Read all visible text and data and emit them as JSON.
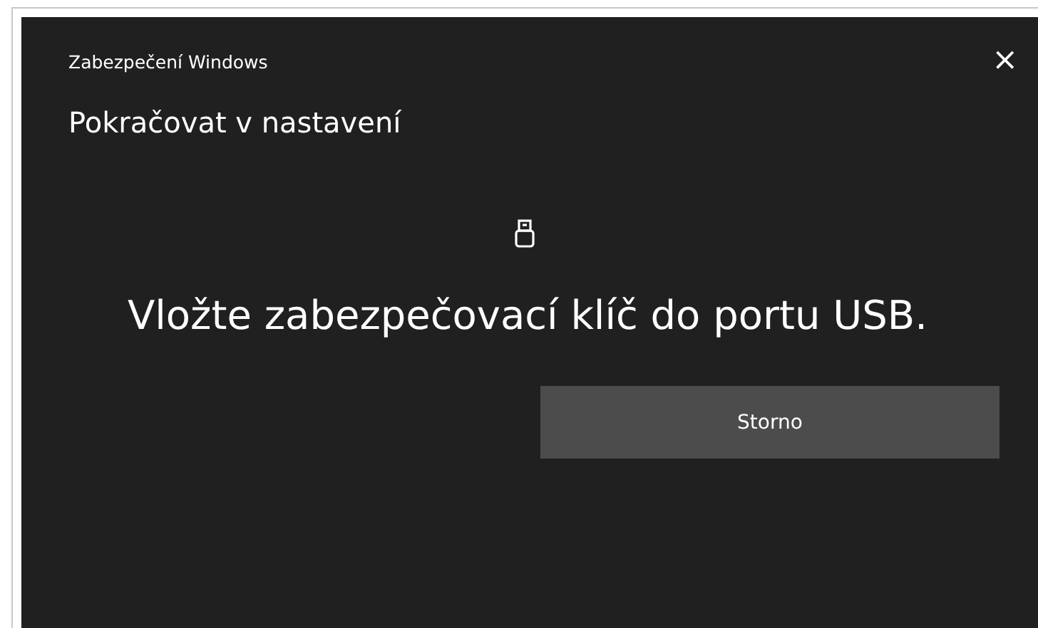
{
  "window": {
    "title": "Zabezpečení Windows",
    "close": "×"
  },
  "heading": "Pokračovat v nastavení",
  "message": "Vložte zabezpečovací klíč do portu USB.",
  "buttons": [
    "Storno"
  ]
}
